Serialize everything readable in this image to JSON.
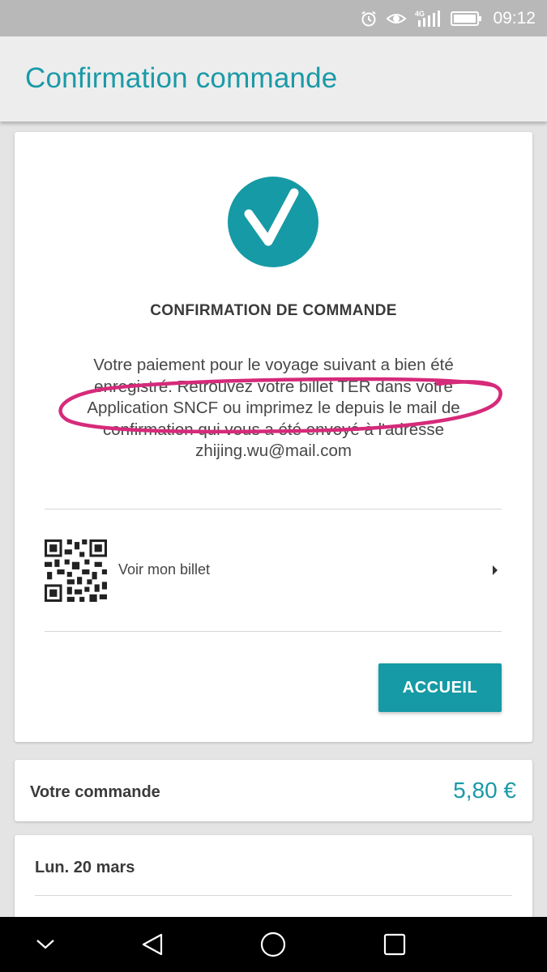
{
  "status_bar": {
    "network": "4G",
    "time": "09:12",
    "icons": [
      "alarm-icon",
      "eye-icon",
      "signal-icon",
      "battery-icon"
    ]
  },
  "app_bar": {
    "title": "Confirmation commande"
  },
  "confirmation": {
    "icon": "check-circle-icon",
    "heading": "CONFIRMATION DE COMMANDE",
    "message": "Votre paiement pour le voyage suivant a bien été enregistré. Retrouvez votre billet TER dans votre Application SNCF ou imprimez le depuis le mail de confirmation qui vous a été envoyé à l'adresse",
    "email": "zhijing.wu@mail.com",
    "ticket_link": {
      "icon": "qr-code-icon",
      "label": "Voir mon billet",
      "chevron": "chevron-right-icon"
    },
    "home_button": "ACCUEIL"
  },
  "order": {
    "label": "Votre commande",
    "price": "5,80 €"
  },
  "trip": {
    "date": "Lun. 20 mars"
  },
  "nav_bar": {
    "buttons": [
      "chevron-down-icon",
      "back-triangle-icon",
      "home-circle-icon",
      "recents-square-icon"
    ]
  },
  "colors": {
    "accent": "#1a9aa7",
    "annotation": "#d62a7a",
    "background": "#e4e4e4"
  }
}
